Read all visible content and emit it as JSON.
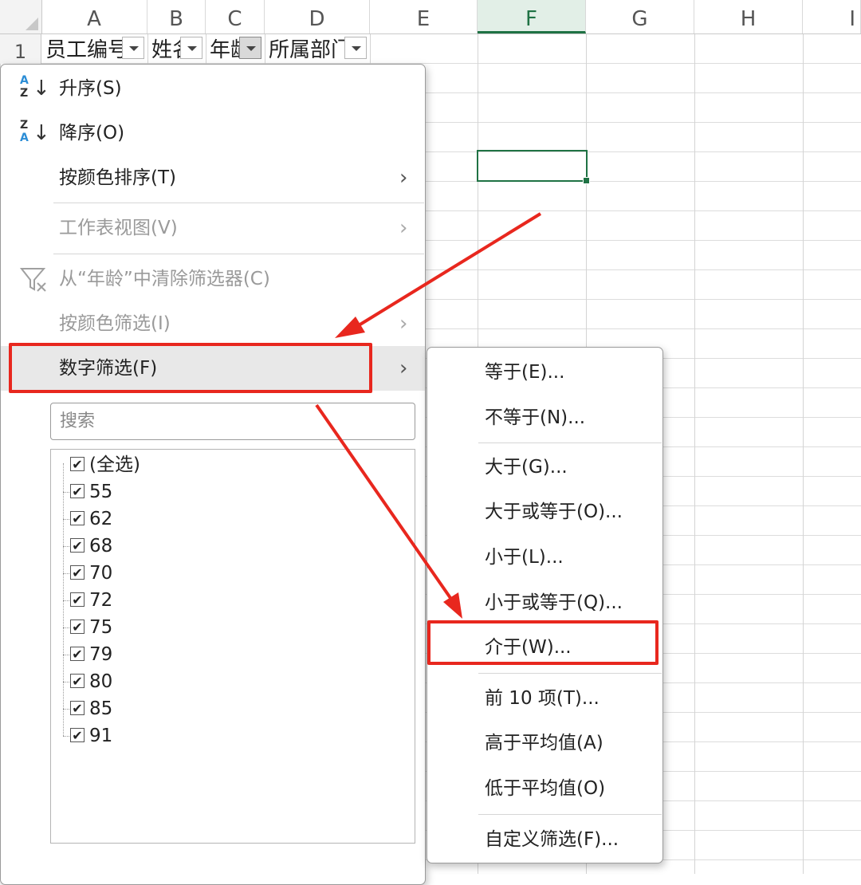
{
  "columns": [
    "A",
    "B",
    "C",
    "D",
    "E",
    "F",
    "G",
    "H",
    "I"
  ],
  "selected_column": "F",
  "row_number": "1",
  "header_cells": [
    "员工编号",
    "姓名",
    "年龄",
    "所属部门"
  ],
  "menu": {
    "sort_asc": "升序(S)",
    "sort_desc": "降序(O)",
    "sort_by_color": "按颜色排序(T)",
    "sheet_view": "工作表视图(V)",
    "clear_filter": "从“年龄”中清除筛选器(C)",
    "filter_by_color": "按颜色筛选(I)",
    "number_filters": "数字筛选(F)",
    "search_placeholder": "搜索",
    "select_all": "(全选)",
    "values": [
      "55",
      "62",
      "68",
      "70",
      "72",
      "75",
      "79",
      "80",
      "85",
      "91"
    ]
  },
  "submenu": {
    "equals": "等于(E)...",
    "not_equals": "不等于(N)...",
    "greater": "大于(G)...",
    "greater_equal": "大于或等于(O)...",
    "less": "小于(L)...",
    "less_equal": "小于或等于(Q)...",
    "between": "介于(W)...",
    "top10": "前 10 项(T)...",
    "above_avg": "高于平均值(A)",
    "below_avg": "低于平均值(O)",
    "custom": "自定义筛选(F)..."
  },
  "colors": {
    "excel_green": "#1f7244",
    "annotation_red": "#e8271e"
  }
}
